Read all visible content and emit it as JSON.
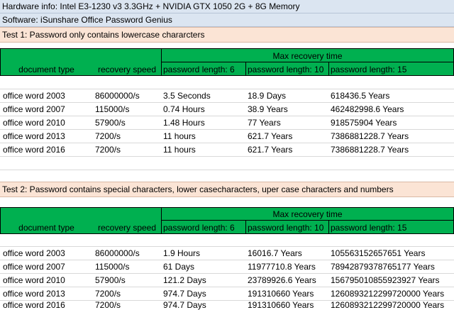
{
  "hardware_info": "Hardware info: Intel E3-1230 v3 3.3GHz + NVIDIA GTX 1050 2G + 8G Memory",
  "software": "Software: iSunshare Office Password Genius",
  "columns": {
    "group_header": "Max recovery time",
    "document_type": "document type",
    "recovery_speed": "recovery speed",
    "len6": "password length: 6",
    "len10": "password length: 10",
    "len15": "password length: 15"
  },
  "tests": [
    {
      "title": "Test 1: Password only contains lowercase chararcters",
      "rows": [
        {
          "doc": "office word 2003",
          "speed": "86000000/s",
          "len6": "3.5 Seconds",
          "len10": "18.9 Days",
          "len15": "618436.5 Years"
        },
        {
          "doc": "office word 2007",
          "speed": "115000/s",
          "len6": "0.74 Hours",
          "len10": "38.9 Years",
          "len15": "462482998.6 Years"
        },
        {
          "doc": "office word 2010",
          "speed": "57900/s",
          "len6": "1.48 Hours",
          "len10": "77 Years",
          "len15": "918575904 Years"
        },
        {
          "doc": "office word 2013",
          "speed": "7200/s",
          "len6": "11 hours",
          "len10": "621.7 Years",
          "len15": "7386881228.7 Years"
        },
        {
          "doc": "office word 2016",
          "speed": "7200/s",
          "len6": "11 hours",
          "len10": "621.7 Years",
          "len15": "7386881228.7 Years"
        }
      ]
    },
    {
      "title": "Test 2: Password contains special characters, lower casecharacters, uper case characters and numbers",
      "rows": [
        {
          "doc": "office word 2003",
          "speed": "86000000/s",
          "len6": "1.9 Hours",
          "len10": "16016.7 Years",
          "len15": "105563152657651 Years"
        },
        {
          "doc": "office word 2007",
          "speed": "115000/s",
          "len6": "61 Days",
          "len10": "11977710.8 Years",
          "len15": "78942879378765177 Years"
        },
        {
          "doc": "office word 2010",
          "speed": "57900/s",
          "len6": "121.2 Days",
          "len10": "23789926.6 Years",
          "len15": "156795010855923927 Years"
        },
        {
          "doc": "office word 2013",
          "speed": "7200/s",
          "len6": "974.7 Days",
          "len10": "191310660 Years",
          "len15": "1260893212299720000 Years"
        },
        {
          "doc": "office word 2016",
          "speed": "7200/s",
          "len6": "974.7 Days",
          "len10": "191310660 Years",
          "len15": "1260893212299720000 Years"
        }
      ]
    }
  ]
}
